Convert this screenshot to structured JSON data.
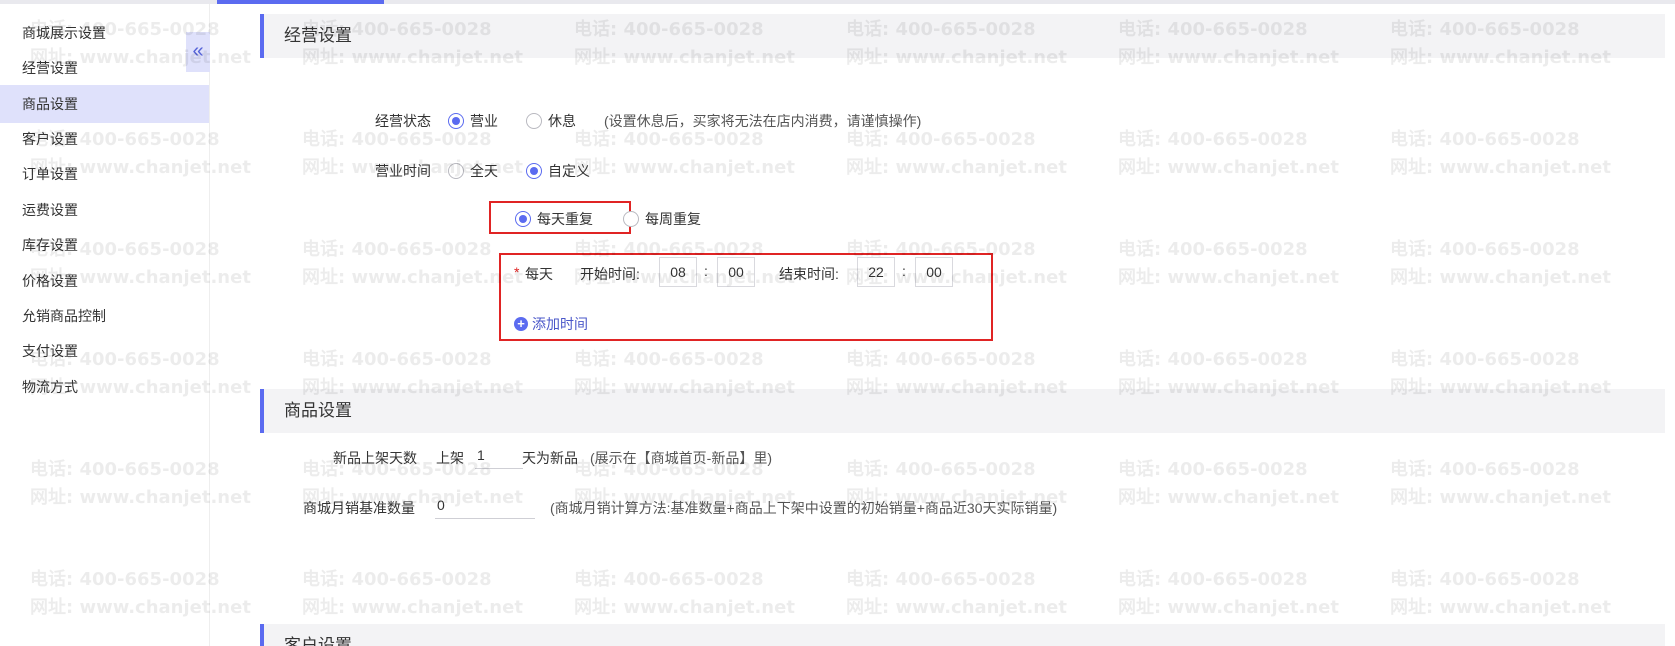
{
  "sidebar": {
    "items": [
      {
        "label": "商城展示设置"
      },
      {
        "label": "经营设置"
      },
      {
        "label": "商品设置"
      },
      {
        "label": "客户设置"
      },
      {
        "label": "订单设置"
      },
      {
        "label": "运费设置"
      },
      {
        "label": "库存设置"
      },
      {
        "label": "价格设置"
      },
      {
        "label": "允销商品控制"
      },
      {
        "label": "支付设置"
      },
      {
        "label": "物流方式"
      }
    ],
    "active_index": 2,
    "collapse_icon": "«"
  },
  "business": {
    "title": "经营设置",
    "status_label": "经营状态",
    "status_options": [
      "营业",
      "休息"
    ],
    "status_selected": "营业",
    "status_hint": "(设置休息后，买家将无法在店内消费，请谨慎操作)",
    "hours_label": "营业时间",
    "hours_options": [
      "全天",
      "自定义"
    ],
    "hours_selected": "自定义",
    "repeat_options": [
      "每天重复",
      "每周重复"
    ],
    "repeat_selected": "每天重复",
    "required_mark": "*",
    "day_label": "每天",
    "start_label": "开始时间:",
    "start_hour": "08",
    "start_minute": "00",
    "end_label": "结束时间:",
    "end_hour": "22",
    "end_minute": "00",
    "colon": ":",
    "add_time_label": "添加时间",
    "add_time_icon": "+"
  },
  "product": {
    "title": "商品设置",
    "new_days_label": "新品上架天数",
    "new_days_prefix": "上架",
    "new_days_value": "1",
    "new_days_suffix": "天为新品",
    "new_days_hint": "(展示在【商城首页-新品】里)",
    "monthly_label": "商城月销基准数量",
    "monthly_value": "0",
    "monthly_hint": "(商城月销计算方法:基准数量+商品上下架中设置的初始销量+商品近30天实际销量)"
  },
  "customer": {
    "title": "客户设置"
  },
  "watermark": {
    "phone": "电话: 400-665-0028",
    "site": "网址: www.chanjet.net"
  },
  "colors": {
    "accent": "#5b6bf0",
    "highlight_box": "#e02424",
    "sidebar_active": "#dfe1fb"
  }
}
